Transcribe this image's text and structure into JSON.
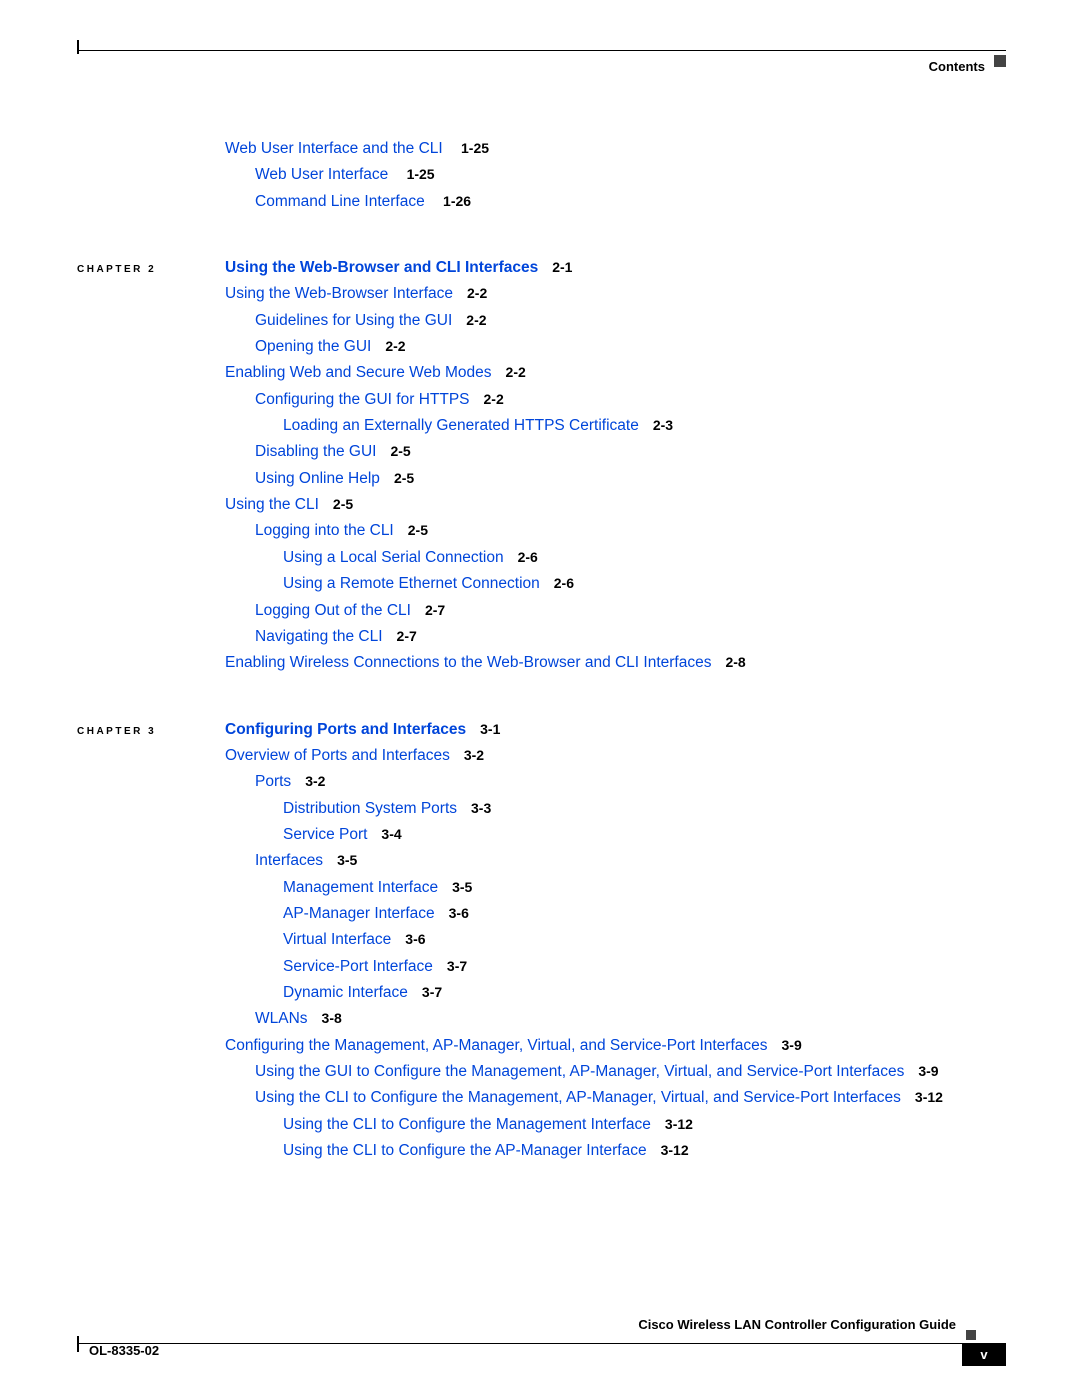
{
  "header": {
    "label": "Contents"
  },
  "top_group": [
    {
      "level": 0,
      "text": "Web User Interface and the CLI",
      "page": "1-25"
    },
    {
      "level": 1,
      "text": "Web User Interface",
      "page": "1-25"
    },
    {
      "level": 1,
      "text": "Command Line Interface",
      "page": "1-26"
    }
  ],
  "chapter2": {
    "label": "CHAPTER 2",
    "title": "Using the Web-Browser and CLI Interfaces",
    "page": "2-1",
    "items": [
      {
        "level": 0,
        "text": "Using the Web-Browser Interface",
        "page": "2-2"
      },
      {
        "level": 1,
        "text": "Guidelines for Using the GUI",
        "page": "2-2"
      },
      {
        "level": 1,
        "text": "Opening the GUI",
        "page": "2-2"
      },
      {
        "level": 0,
        "text": "Enabling Web and Secure Web Modes",
        "page": "2-2"
      },
      {
        "level": 1,
        "text": "Configuring the GUI for HTTPS",
        "page": "2-2"
      },
      {
        "level": 2,
        "text": "Loading an Externally Generated HTTPS Certificate",
        "page": "2-3"
      },
      {
        "level": 1,
        "text": "Disabling the GUI",
        "page": "2-5"
      },
      {
        "level": 1,
        "text": "Using Online Help",
        "page": "2-5"
      },
      {
        "level": 0,
        "text": "Using the CLI",
        "page": "2-5"
      },
      {
        "level": 1,
        "text": "Logging into the CLI",
        "page": "2-5"
      },
      {
        "level": 2,
        "text": "Using a Local Serial Connection",
        "page": "2-6"
      },
      {
        "level": 2,
        "text": "Using a Remote Ethernet Connection",
        "page": "2-6"
      },
      {
        "level": 1,
        "text": "Logging Out of the CLI",
        "page": "2-7"
      },
      {
        "level": 1,
        "text": "Navigating the CLI",
        "page": "2-7"
      },
      {
        "level": 0,
        "text": "Enabling Wireless Connections to the Web-Browser and CLI Interfaces",
        "page": "2-8"
      }
    ]
  },
  "chapter3": {
    "label": "CHAPTER 3",
    "title": "Configuring Ports and Interfaces",
    "page": "3-1",
    "items": [
      {
        "level": 0,
        "text": "Overview of Ports and Interfaces",
        "page": "3-2"
      },
      {
        "level": 1,
        "text": "Ports",
        "page": "3-2"
      },
      {
        "level": 2,
        "text": "Distribution System Ports",
        "page": "3-3"
      },
      {
        "level": 2,
        "text": "Service Port",
        "page": "3-4"
      },
      {
        "level": 1,
        "text": "Interfaces",
        "page": "3-5"
      },
      {
        "level": 2,
        "text": "Management Interface",
        "page": "3-5"
      },
      {
        "level": 2,
        "text": "AP-Manager Interface",
        "page": "3-6"
      },
      {
        "level": 2,
        "text": "Virtual Interface",
        "page": "3-6"
      },
      {
        "level": 2,
        "text": "Service-Port Interface",
        "page": "3-7"
      },
      {
        "level": 2,
        "text": "Dynamic Interface",
        "page": "3-7"
      },
      {
        "level": 1,
        "text": "WLANs",
        "page": "3-8"
      },
      {
        "level": 0,
        "text": "Configuring the Management, AP-Manager, Virtual, and Service-Port Interfaces",
        "page": "3-9"
      },
      {
        "level": 1,
        "text": "Using the GUI to Configure the Management, AP-Manager, Virtual, and Service-Port Interfaces",
        "page": "3-9"
      },
      {
        "level": 1,
        "text": "Using the CLI to Configure the Management, AP-Manager, Virtual, and Service-Port Interfaces",
        "page": "3-12"
      },
      {
        "level": 2,
        "text": "Using the CLI to Configure the Management Interface",
        "page": "3-12"
      },
      {
        "level": 2,
        "text": "Using the CLI to Configure the AP-Manager Interface",
        "page": "3-12"
      }
    ]
  },
  "footer": {
    "title": "Cisco Wireless LAN Controller Configuration Guide",
    "code": "OL-8335-02",
    "page": "v"
  }
}
